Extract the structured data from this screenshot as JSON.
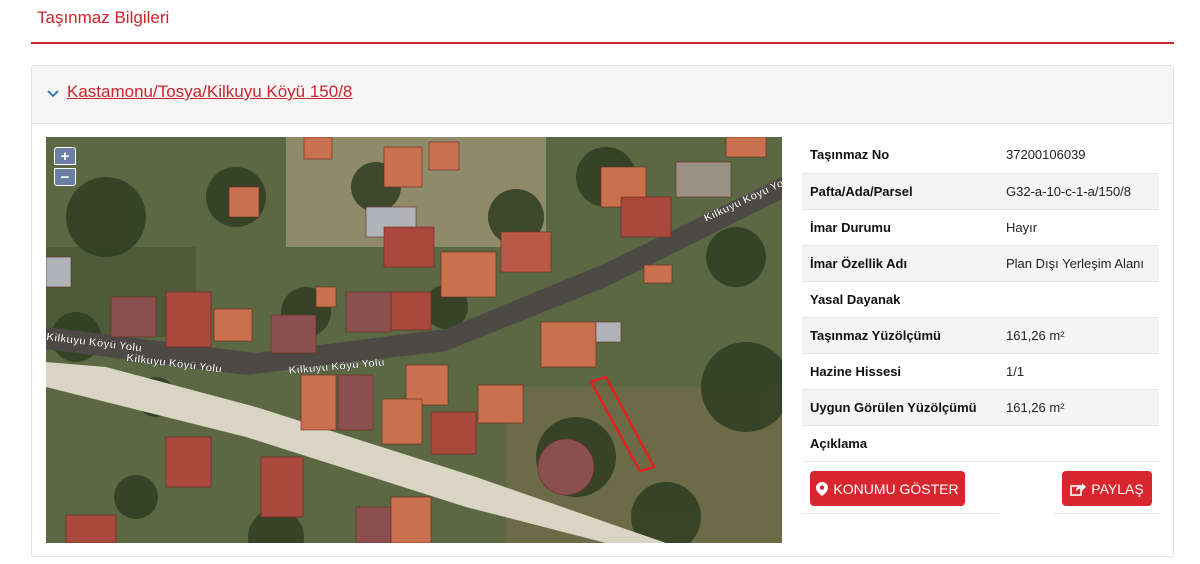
{
  "header": {
    "title": "Taşınmaz Bilgileri"
  },
  "card": {
    "location_link": "Kastamonu/Tosya/Kilkuyu Köyü 150/8"
  },
  "map": {
    "zoom_in": "+",
    "zoom_out": "−",
    "road_label_1": "Kilkuyu Köyü Yolu",
    "road_label_2": "Kilkuyu Köyü Yolu",
    "road_label_3": "Kilkuyu Köyü Yolu",
    "road_label_4": "Kilkuyu Köyü Yolu",
    "parcel_color": "#e02020"
  },
  "details": [
    {
      "label": "Taşınmaz No",
      "value": "37200106039"
    },
    {
      "label": "Pafta/Ada/Parsel",
      "value": "G32-a-10-c-1-a/150/8"
    },
    {
      "label": "İmar Durumu",
      "value": "Hayır"
    },
    {
      "label": "İmar Özellik Adı",
      "value": "Plan Dışı Yerleşim Alanı"
    },
    {
      "label": "Yasal Dayanak",
      "value": ""
    },
    {
      "label": "Taşınmaz Yüzölçümü",
      "value": "161,26 m²"
    },
    {
      "label": "Hazine Hissesi",
      "value": "1/1"
    },
    {
      "label": "Uygun Görülen Yüzölçümü",
      "value": "161,26 m²"
    },
    {
      "label": "Açıklama",
      "value": ""
    }
  ],
  "buttons": {
    "konum": "KONUMU GÖSTER",
    "paylas": "PAYLAŞ"
  },
  "colors": {
    "accent": "#c9252c",
    "button": "#d8262e"
  }
}
